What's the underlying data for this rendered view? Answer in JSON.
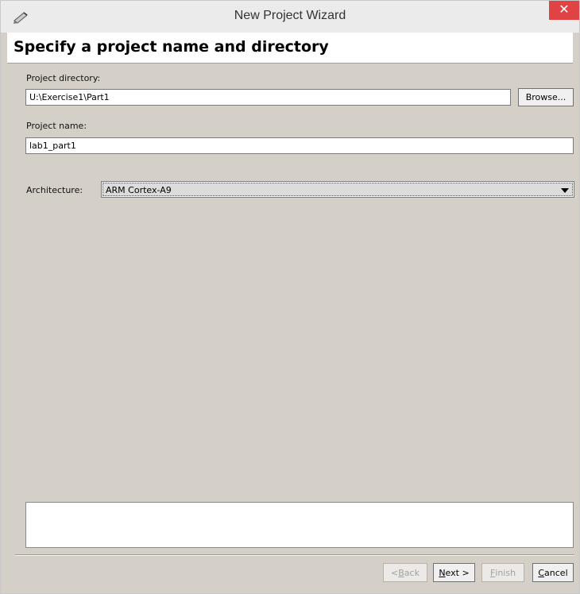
{
  "window": {
    "title": "New Project Wizard",
    "close_glyph": "✕"
  },
  "header": {
    "title": "Specify a project name and directory"
  },
  "form": {
    "directory_label": "Project directory:",
    "directory_value": "U:\\Exercise1\\Part1",
    "browse_label": "Browse...",
    "name_label": "Project name:",
    "name_value": "lab1_part1",
    "architecture_label": "Architecture:",
    "architecture_value": "ARM Cortex-A9"
  },
  "message_area": {
    "text": ""
  },
  "footer": {
    "back": {
      "mnemonic": "B",
      "rest": "ack",
      "prefix": "< ",
      "enabled": false
    },
    "next": {
      "mnemonic": "N",
      "rest": "ext >",
      "prefix": "",
      "enabled": true
    },
    "finish": {
      "mnemonic": "F",
      "rest": "inish",
      "prefix": "",
      "enabled": false
    },
    "cancel": {
      "mnemonic": "C",
      "rest": "ancel",
      "prefix": "",
      "enabled": true
    }
  },
  "icons": {
    "app": "pencil-icon",
    "close": "close-icon",
    "dropdown": "chevron-down-icon"
  },
  "colors": {
    "close_button": "#e04343",
    "dialog_background": "#d4d0c8",
    "titlebar": "#ebebeb"
  }
}
